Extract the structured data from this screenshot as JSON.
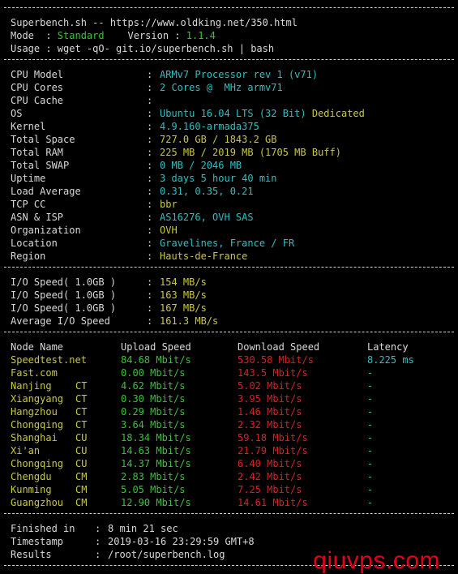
{
  "header": {
    "line1": "Superbench.sh -- https://www.oldking.net/350.html",
    "mode_label": "Mode  : ",
    "mode_value": "Standard",
    "version_label": "    Version : ",
    "version_value": "1.1.4",
    "usage": "Usage : wget -qO- git.io/superbench.sh | bash"
  },
  "sysinfo": [
    {
      "label": "CPU Model",
      "value": "ARMv7 Processor rev 1 (v71)",
      "color": "cy"
    },
    {
      "label": "CPU Cores",
      "value": "2 Cores @  MHz armv71",
      "color": "cy"
    },
    {
      "label": "CPU Cache",
      "value": "",
      "color": "cy"
    },
    {
      "label": "OS",
      "value": "Ubuntu 16.04 LTS (32 Bit)",
      "extra": " Dedicated",
      "color": "cy"
    },
    {
      "label": "Kernel",
      "value": "4.9.160-armada375",
      "color": "cy"
    },
    {
      "label": "Total Space",
      "value": "727.0 GB / 1843.2 GB",
      "color": "y"
    },
    {
      "label": "Total RAM",
      "value": "225 MB / 2019 MB (1705 MB Buff)",
      "color": "y"
    },
    {
      "label": "Total SWAP",
      "value": "0 MB / 2046 MB",
      "color": "cy"
    },
    {
      "label": "Uptime",
      "value": "3 days 5 hour 40 min",
      "color": "cy"
    },
    {
      "label": "Load Average",
      "value": "0.31, 0.35, 0.21",
      "color": "cy"
    },
    {
      "label": "TCP CC",
      "value": "bbr",
      "color": "y"
    },
    {
      "label": "ASN & ISP",
      "value": "AS16276, OVH SAS",
      "color": "cy"
    },
    {
      "label": "Organization",
      "value": "OVH",
      "color": "y"
    },
    {
      "label": "Location",
      "value": "Gravelines, France / FR",
      "color": "cy"
    },
    {
      "label": "Region",
      "value": "Hauts-de-France",
      "color": "y"
    }
  ],
  "io": [
    {
      "label": "I/O Speed( 1.0GB )",
      "value": "154 MB/s"
    },
    {
      "label": "I/O Speed( 1.0GB )",
      "value": "163 MB/s"
    },
    {
      "label": "I/O Speed( 1.0GB )",
      "value": "167 MB/s"
    },
    {
      "label": "Average I/O Speed",
      "value": "161.3 MB/s"
    }
  ],
  "speed_headers": {
    "node": "Node Name",
    "upload": "Upload Speed",
    "download": "Download Speed",
    "latency": "Latency"
  },
  "speedtests": [
    {
      "node": "Speedtest.net",
      "isp": "",
      "upload": "84.68 Mbit/s",
      "download": "530.58 Mbit/s",
      "latency": "8.225 ms"
    },
    {
      "node": "Fast.com",
      "isp": "",
      "upload": "0.00 Mbit/s",
      "download": "143.5 Mbit/s",
      "latency": "-"
    },
    {
      "node": "Nanjing",
      "isp": "CT",
      "upload": "4.62 Mbit/s",
      "download": "5.02 Mbit/s",
      "latency": "-"
    },
    {
      "node": "Xiangyang",
      "isp": "CT",
      "upload": "0.30 Mbit/s",
      "download": "3.95 Mbit/s",
      "latency": "-"
    },
    {
      "node": "Hangzhou",
      "isp": "CT",
      "upload": "0.29 Mbit/s",
      "download": "1.46 Mbit/s",
      "latency": "-"
    },
    {
      "node": "Chongqing",
      "isp": "CT",
      "upload": "3.64 Mbit/s",
      "download": "2.32 Mbit/s",
      "latency": "-"
    },
    {
      "node": "Shanghai",
      "isp": "CU",
      "upload": "18.34 Mbit/s",
      "download": "59.18 Mbit/s",
      "latency": "-"
    },
    {
      "node": "Xi'an",
      "isp": "CU",
      "upload": "14.63 Mbit/s",
      "download": "21.79 Mbit/s",
      "latency": "-"
    },
    {
      "node": "Chongqing",
      "isp": "CU",
      "upload": "14.37 Mbit/s",
      "download": "6.40 Mbit/s",
      "latency": "-"
    },
    {
      "node": "Chengdu",
      "isp": "CM",
      "upload": "2.83 Mbit/s",
      "download": "2.42 Mbit/s",
      "latency": "-"
    },
    {
      "node": "Kunming",
      "isp": "CM",
      "upload": "5.05 Mbit/s",
      "download": "7.25 Mbit/s",
      "latency": "-"
    },
    {
      "node": "Guangzhou",
      "isp": "CM",
      "upload": "12.90 Mbit/s",
      "download": "14.61 Mbit/s",
      "latency": "-"
    }
  ],
  "footer": [
    {
      "label": "Finished in",
      "value": "8 min 21 sec"
    },
    {
      "label": "Timestamp",
      "value": "2019-03-16 23:29:59 GMT+8"
    },
    {
      "label": "Results",
      "value": "/root/superbench.log"
    }
  ],
  "watermark": "qiuvps.com",
  "colors": {
    "background": "#000000",
    "text": "#d8d8d8",
    "green": "#35c435",
    "yellow": "#c9c93a",
    "cyan": "#2cc0c0",
    "red": "#d82020",
    "watermark": "#e3001b"
  }
}
